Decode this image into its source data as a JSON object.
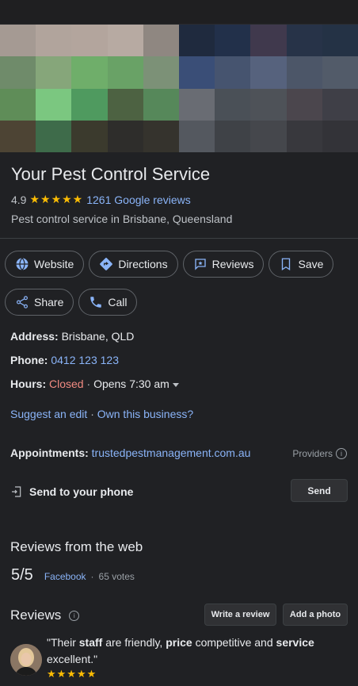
{
  "business": {
    "name": "Your Pest Control Service",
    "rating": "4.9",
    "stars": "★★★★★",
    "reviews_link": "1261 Google reviews",
    "category": "Pest control service in Brisbane, Queensland"
  },
  "actions": {
    "website": "Website",
    "directions": "Directions",
    "reviews": "Reviews",
    "save": "Save",
    "share": "Share",
    "call": "Call"
  },
  "info": {
    "address_label": "Address:",
    "address_value": "Brisbane, QLD",
    "phone_label": "Phone:",
    "phone_value": "0412 123 123",
    "hours_label": "Hours:",
    "hours_status": "Closed",
    "hours_sep": "·",
    "hours_next": "Opens 7:30 am",
    "suggest_edit": "Suggest an edit",
    "links_sep": "·",
    "own_business": "Own this business?",
    "appointments_label": "Appointments:",
    "appointments_value": "trustedpestmanagement.com.au",
    "providers": "Providers"
  },
  "send_to_phone": {
    "label": "Send to your phone",
    "button": "Send"
  },
  "web_reviews": {
    "title": "Reviews from the web",
    "score": "5/5",
    "source": "Facebook",
    "sep": "·",
    "votes": "65 votes"
  },
  "reviews": {
    "title": "Reviews",
    "write_button": "Write a review",
    "photo_button": "Add a photo",
    "items": [
      {
        "q_open": "\"Their ",
        "w1": "staff",
        "t1": " are friendly, ",
        "w2": "price",
        "t2": " competitive and ",
        "w3": "service",
        "t3": " excellent.\"",
        "stars": "★★★★★"
      }
    ]
  },
  "colors": {
    "background": "#202124",
    "link": "#8ab4f8",
    "closed": "#f28b82",
    "star": "#fbbc04"
  }
}
